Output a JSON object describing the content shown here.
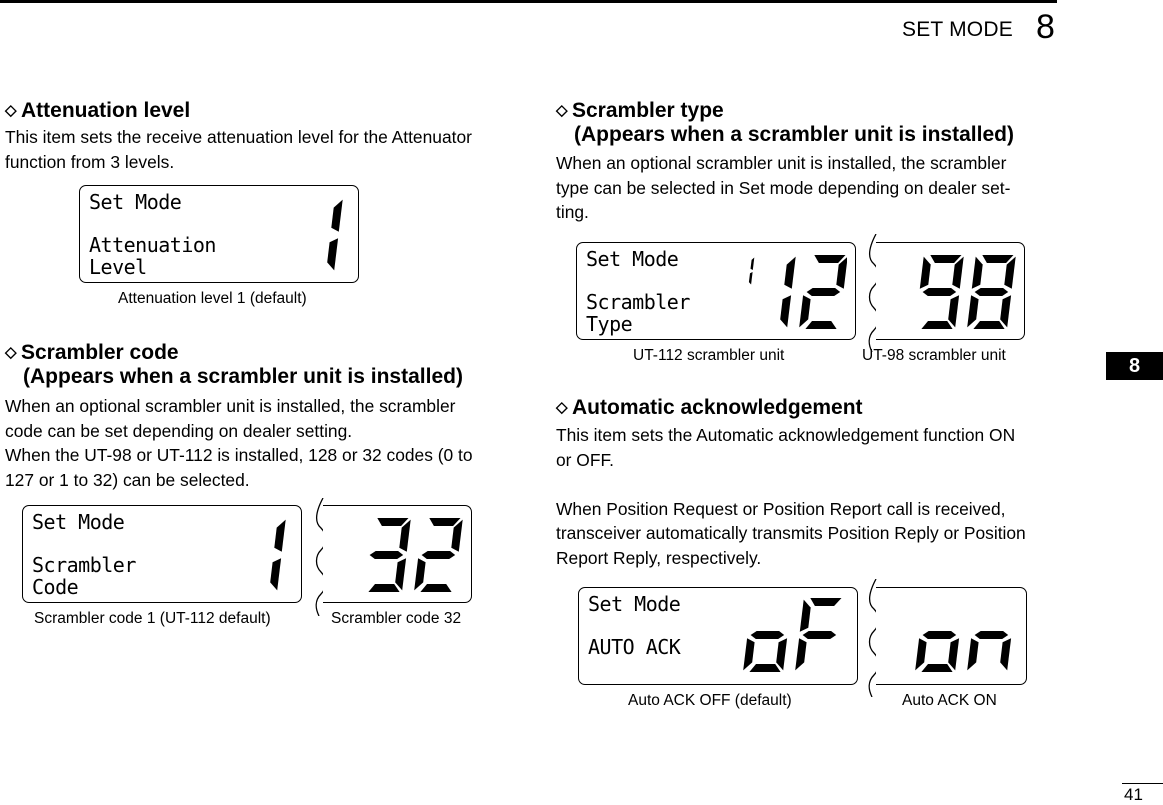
{
  "page": {
    "section_title": "SET MODE",
    "section_number": "8",
    "tab_label": "8",
    "page_number": "41"
  },
  "left": {
    "attenuation": {
      "heading": "Attenuation level",
      "body": [
        "This item sets the receive attenuation level for the Attenuator",
        "function from 3 levels."
      ],
      "display": {
        "line1": "Set Mode",
        "line2": "Attenuation",
        "line3": "Level",
        "value": "1"
      },
      "caption": "Attenuation level 1 (default)"
    },
    "scrambler_code": {
      "heading": "Scrambler code",
      "subheading": "(Appears when a scrambler unit is installed)",
      "body": [
        "When an optional scrambler unit is installed, the scrambler",
        "code can be set depending on dealer setting.",
        "When the UT-98 or UT-112 is installed, 128 or 32 codes (0 to",
        "127 or 1 to 32) can be selected."
      ],
      "display": {
        "line1": "Set Mode",
        "line2": "Scrambler",
        "line3": "Code",
        "value": "1"
      },
      "alt_display": {
        "value": "32"
      },
      "caption": "Scrambler code 1 (UT-112 default)",
      "alt_caption": "Scrambler code 32"
    }
  },
  "right": {
    "scrambler_type": {
      "heading": "Scrambler type",
      "subheading": "(Appears when a scrambler unit is installed)",
      "body": [
        "When an optional scrambler unit is installed, the scrambler",
        "type can be selected in Set mode depending on dealer set-",
        "ting."
      ],
      "display": {
        "line1": "Set Mode",
        "line2": "Scrambler",
        "line3": "Type",
        "value": "112"
      },
      "alt_display": {
        "value": "98"
      },
      "caption": "UT-112 scrambler unit",
      "alt_caption": "UT-98 scrambler unit"
    },
    "auto_ack": {
      "heading": "Automatic acknowledgement",
      "body": [
        "This item sets the Automatic acknowledgement function ON",
        "or OFF.",
        "",
        "When Position Request or Position Report call is received,",
        "transceiver automatically transmits Position Reply or Position",
        "Report Reply, respectively."
      ],
      "display": {
        "line1": "Set Mode",
        "line2": "AUTO ACK",
        "value": "oF"
      },
      "alt_display": {
        "value": "on"
      },
      "caption": "Auto ACK OFF (default)",
      "alt_caption": "Auto ACK ON"
    }
  }
}
